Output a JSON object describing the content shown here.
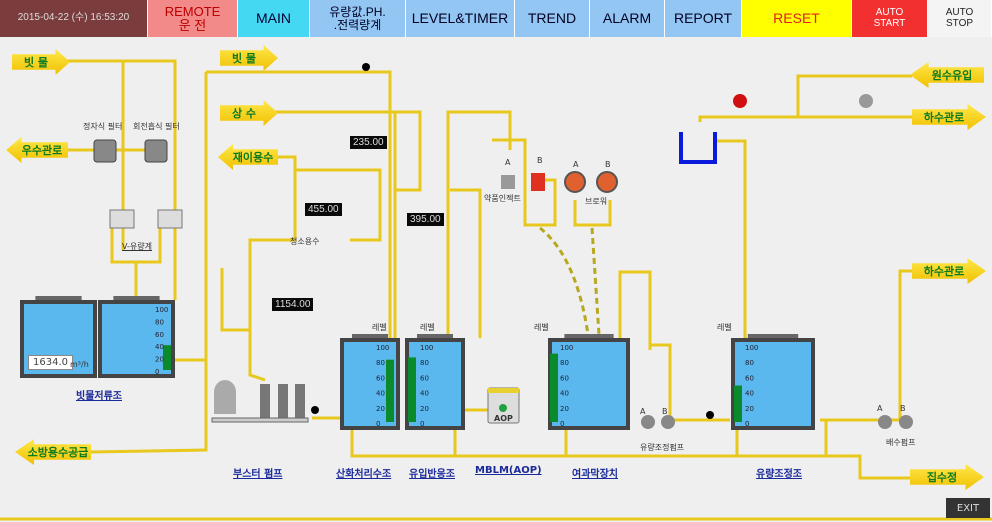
{
  "topbar": {
    "datetime": "2015-04-22 (수) 16:53:20",
    "remote": "REMOTE\n운 전",
    "main": "MAIN",
    "flow_ph_power": "유량값.PH.\n.전력량계",
    "level_timer": "LEVEL&TIMER",
    "trend": "TREND",
    "alarm": "ALARM",
    "report": "REPORT",
    "reset": "RESET",
    "auto_start": "AUTO\nSTART",
    "auto_stop": "AUTO\nSTOP"
  },
  "arrows": {
    "rainwater1": "빗 물",
    "rainwater2": "빗 물",
    "storm_drain": "우수관로",
    "tap_water": "상 수",
    "reuse_water": "재이용수",
    "fire_water": "소방용수공급",
    "raw_inflow": "원수유입",
    "sewer1": "하수관로",
    "sewer2": "하수관로",
    "sump": "집수정"
  },
  "labels": {
    "filter1": "정자식 필터",
    "filter2": "회전흡식 필터",
    "v_flowmeter": "V-유량계",
    "cleaning_water": "청소용수",
    "chem_pump": "약품인젝트",
    "blower": "브로워",
    "flow_adjust_pump": "유량조정펌프",
    "drain_pump": "배수펌프",
    "level": "레벨",
    "pump_a": "A",
    "pump_b": "B",
    "unit": "m³/h",
    "aop": "AOP"
  },
  "links": {
    "rain_storage": "빗물저류조",
    "booster_pump": "부스터 펌프",
    "oxidation_tank": "산화처리수조",
    "inflow_reactor": "유입반응조",
    "mblm": "MBLM(AOP)",
    "membrane": "여과막장치",
    "flow_adjust_tank": "유량조정조"
  },
  "meters": {
    "m1": "235.00",
    "m2": "455.00",
    "m3": "395.00",
    "m4": "1154.00",
    "storage_volume": "1634.0"
  },
  "tank_levels_percent": {
    "rain_storage": 40,
    "oxidation_tank": 82,
    "inflow_reactor": 85,
    "membrane": 90,
    "flow_adjust_tank": 48
  },
  "scale_ticks": [
    "100",
    "80",
    "60",
    "40",
    "20",
    "0"
  ],
  "exit": "EXIT",
  "colors": {
    "pipe": "#e8c81c",
    "water": "#5ab8ee",
    "level_bar": "#0a8a2a",
    "arrow_text": "#0a7a20"
  }
}
